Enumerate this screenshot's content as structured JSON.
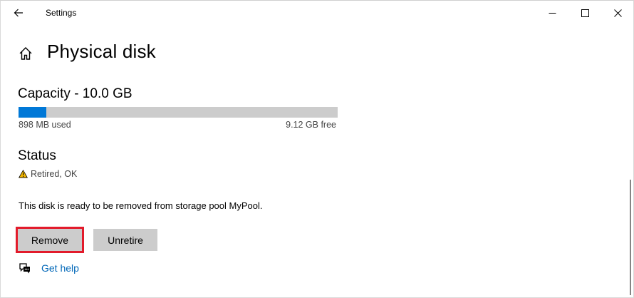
{
  "window": {
    "title": "Settings"
  },
  "page": {
    "title": "Physical disk"
  },
  "capacity": {
    "heading": "Capacity - 10.0 GB",
    "used_label": "898 MB used",
    "free_label": "9.12 GB free",
    "used_fraction": 0.0877,
    "bar_color": "#0078d7"
  },
  "status": {
    "heading": "Status",
    "value": "Retired, OK",
    "icon": "warning-icon"
  },
  "info": {
    "text": "This disk is ready to be removed from storage pool MyPool."
  },
  "buttons": {
    "remove": "Remove",
    "unretire": "Unretire"
  },
  "help": {
    "label": "Get help",
    "icon": "help-chat-icon"
  },
  "colors": {
    "accent": "#0078d7",
    "link": "#0067b8",
    "highlight": "#e21b2b",
    "warning": "#f2b600"
  }
}
